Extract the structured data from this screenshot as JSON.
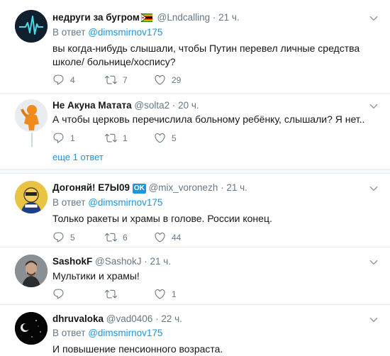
{
  "colors": {
    "link": "#1b95e0",
    "secondary": "#657786",
    "primary_text": "#14171a"
  },
  "tweets": [
    {
      "name": "недруги за бугром",
      "handle": "@Lndcalling",
      "time": "· 21 ч.",
      "reply_prefix": "В ответ",
      "reply_to": "@dimsmirnov175",
      "text": "вы когда-нибудь слышали, чтобы Путин перевел личные средства школе/ больнице/хоспису?",
      "replies": "4",
      "retweets": "7",
      "likes": "29"
    },
    {
      "name": "Не Акуна Матата",
      "handle": "@solta2",
      "time": "· 20 ч.",
      "text": "А чтобы церковь перечислила больному ребёнку, слышали? Я нет..",
      "replies": "1",
      "retweets": "1",
      "likes": "5"
    },
    {
      "name": "Догоняй! Е7Ы09",
      "handle": "@mix_voronezh",
      "time": "· 21 ч.",
      "badge": "OK",
      "reply_prefix": "В ответ",
      "reply_to": "@dimsmirnov175",
      "text": "Только ракеты и храмы в голове. России конец.",
      "replies": "5",
      "retweets": "6",
      "likes": "44"
    },
    {
      "name": "SashokF",
      "handle": "@SashokJ",
      "time": "· 21 ч.",
      "text": "Мультики и храмы!",
      "replies": "",
      "retweets": "",
      "likes": "1"
    },
    {
      "name": "dhruvaloka",
      "handle": "@vad0406",
      "time": "· 22 ч.",
      "reply_prefix": "В ответ",
      "reply_to": "@dimsmirnov175",
      "text": "И повышение пенсионного возраста."
    }
  ],
  "show_more": "еще 1 ответ",
  "icons": [
    "reply-icon",
    "retweet-icon",
    "like-icon",
    "chevron-down-icon",
    "zimbabwe-flag-icon"
  ]
}
